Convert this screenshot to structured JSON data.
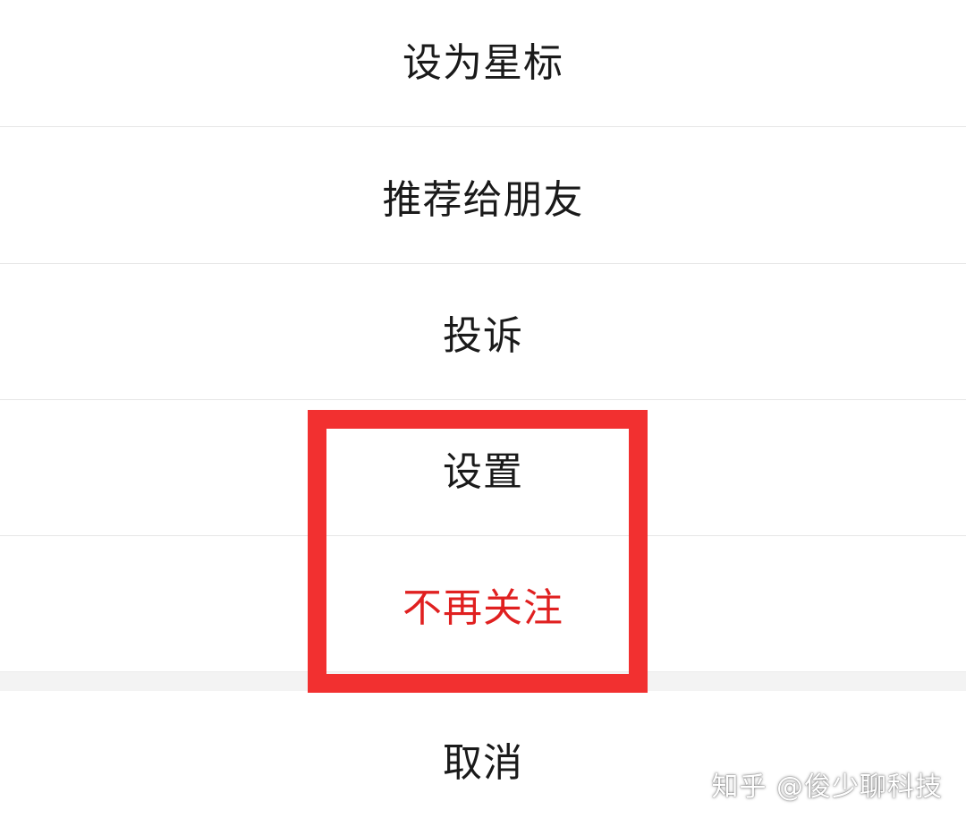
{
  "action_sheet": {
    "items": [
      {
        "label": "设为星标"
      },
      {
        "label": "推荐给朋友"
      },
      {
        "label": "投诉"
      },
      {
        "label": "设置"
      },
      {
        "label": "不再关注",
        "color": "#e02020"
      }
    ],
    "cancel_label": "取消"
  },
  "annotation": {
    "highlight_color": "#f23030",
    "highlighted_items": [
      "设置",
      "不再关注"
    ]
  },
  "watermark": {
    "text": "知乎 @俊少聊科技"
  }
}
